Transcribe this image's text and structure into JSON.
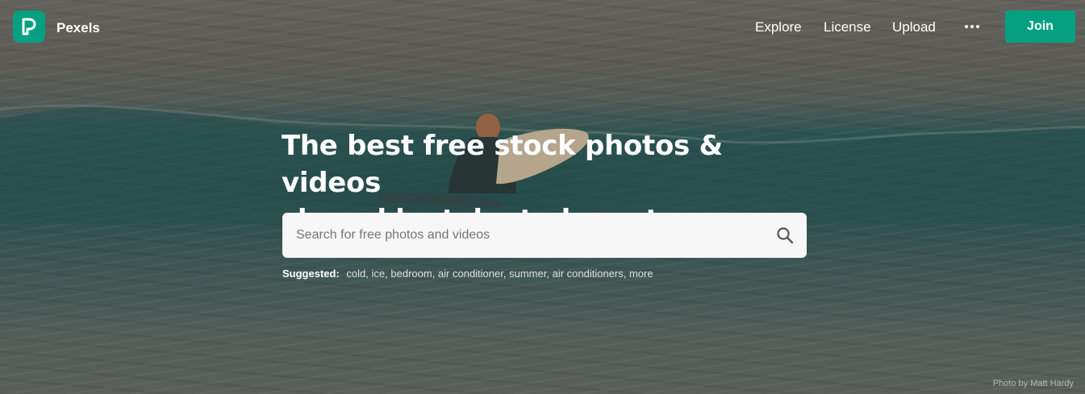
{
  "header": {
    "brand": "Pexels",
    "logo_icon": "pexels-logo-icon",
    "nav": {
      "explore": "Explore",
      "license": "License",
      "upload": "Upload",
      "more_icon": "ellipsis-icon"
    },
    "join_label": "Join"
  },
  "hero": {
    "headline_line1": "The best free stock photos & videos",
    "headline_line2": "shared by talented creators.",
    "search": {
      "placeholder": "Search for free photos and videos",
      "value": "",
      "icon": "search-icon"
    },
    "suggested": {
      "label": "Suggested:",
      "tags": [
        "cold",
        "ice",
        "bedroom",
        "air conditioner",
        "summer",
        "air conditioners",
        "more"
      ]
    },
    "photo_credit": "Photo by Matt Hardy"
  },
  "colors": {
    "accent": "#05a081",
    "search_bg": "#f7f7f7"
  }
}
